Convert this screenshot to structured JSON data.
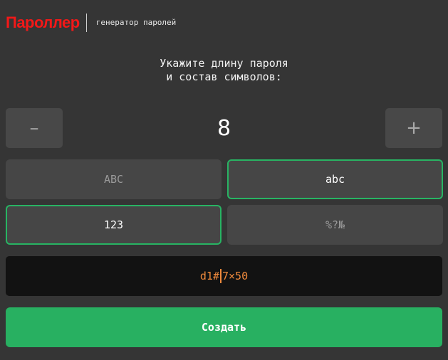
{
  "header": {
    "logo": "Пароллер",
    "tagline": "генератор паролей"
  },
  "prompt": {
    "line1": "Укажите длину пароля",
    "line2": "и состав символов:"
  },
  "length": {
    "minus_label": "–",
    "plus_label": "+",
    "value": "8"
  },
  "charsets": {
    "upper": {
      "label": "ABC",
      "selected": false
    },
    "lower": {
      "label": "abc",
      "selected": true
    },
    "digits": {
      "label": "123",
      "selected": true
    },
    "special": {
      "label": "%?№",
      "selected": false
    }
  },
  "output": {
    "before_cursor": "d1#",
    "after_cursor": "7×50"
  },
  "create_button": {
    "label": "Создать"
  },
  "colors": {
    "background": "#353535",
    "logo": "#f31818",
    "accent_green": "#28b061",
    "password_text": "#f08a3c"
  }
}
